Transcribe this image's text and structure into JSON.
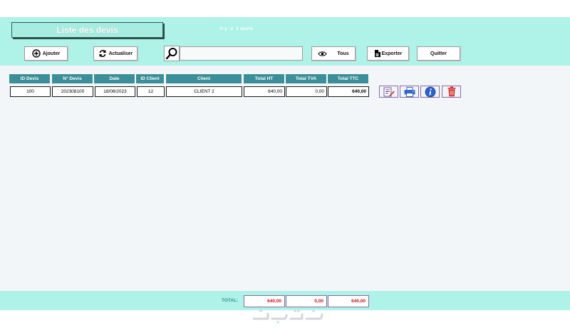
{
  "app": {
    "title": "Liste des devis",
    "count_parts": [
      "Il y",
      "a",
      "1 devis"
    ]
  },
  "toolbar": {
    "add_label": "Ajouter",
    "refresh_label": "Actualiser",
    "search_value": "",
    "all_label": "Tous",
    "export_label": "Exporter",
    "quit_label": "Quitter"
  },
  "table": {
    "headers": [
      "ID Devis",
      "N° Devis",
      "Date",
      "ID Client",
      "Client",
      "Total HT",
      "Total TVA",
      "Total TTC"
    ],
    "rows": [
      [
        "100",
        "202308100",
        "18/08/2023",
        "12",
        "CLIENT 2",
        "640,00",
        "0,00",
        "640,00"
      ]
    ]
  },
  "row_actions": [
    "edit-document-icon",
    "print-icon",
    "info-icon",
    "trash-icon"
  ],
  "footer": {
    "total_label": "TOTAL:",
    "total_ht": "640,00",
    "total_tva": "0,00",
    "total_ttc": "640,00"
  },
  "colors": {
    "band": "#aef2e8",
    "header_cell": "#3a8f99",
    "total_value": "#c81818",
    "action_border": "#8a6aa8"
  }
}
